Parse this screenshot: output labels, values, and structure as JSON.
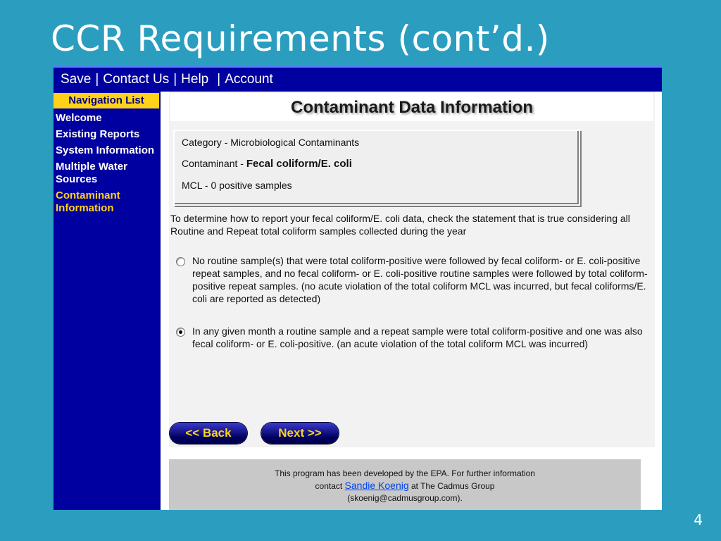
{
  "slide": {
    "title": "CCR Requirements (cont’d.)",
    "page_number": "4"
  },
  "topbar": {
    "save": "Save",
    "contact": "Contact Us",
    "help": "Help",
    "account": "Account",
    "separator": "|"
  },
  "sidebar": {
    "header": "Navigation List",
    "items": [
      {
        "label": "Welcome"
      },
      {
        "label": "Existing Reports"
      },
      {
        "label": "System Information"
      },
      {
        "label": "Multiple Water Sources"
      },
      {
        "label": "Contaminant Information"
      }
    ]
  },
  "main": {
    "heading": "Contaminant Data Information",
    "info": {
      "category": "Category - Microbiological Contaminants",
      "contaminant_label": "Contaminant - ",
      "contaminant_value": "Fecal coliform/E. coli",
      "mcl": "MCL - 0 positive samples"
    },
    "intro": "To determine how to report your fecal coliform/E. coli data, check the statement that is true considering all Routine and Repeat total coliform samples collected during the year",
    "options": [
      {
        "text": "No routine sample(s) that were total coliform-positive were followed by fecal coliform- or E. coli-positive repeat samples, and no fecal coliform- or E. coli-positive routine samples were followed by total coliform-positive repeat samples. (no acute violation of the total coliform MCL was incurred, but fecal coliforms/E. coli are reported as detected)",
        "checked": false
      },
      {
        "text": "In any given month a routine sample and a repeat sample were total coliform-positive and one was also fecal coliform- or E. coli-positive. (an acute violation of the total coliform MCL was incurred)",
        "checked": true
      }
    ],
    "back_label": "<< Back",
    "next_label": "Next >>"
  },
  "footer": {
    "line1": "This program has been developed by the EPA. For further information",
    "contact_prefix": "contact ",
    "contact_link": "Sandie Koenig",
    "contact_suffix": " at The Cadmus Group",
    "email": "(skoenig@cadmusgroup.com)."
  },
  "colors": {
    "slide_bg": "#2b9ec0",
    "nav_bg": "#0000a0",
    "accent_yellow": "#ffd21a"
  }
}
